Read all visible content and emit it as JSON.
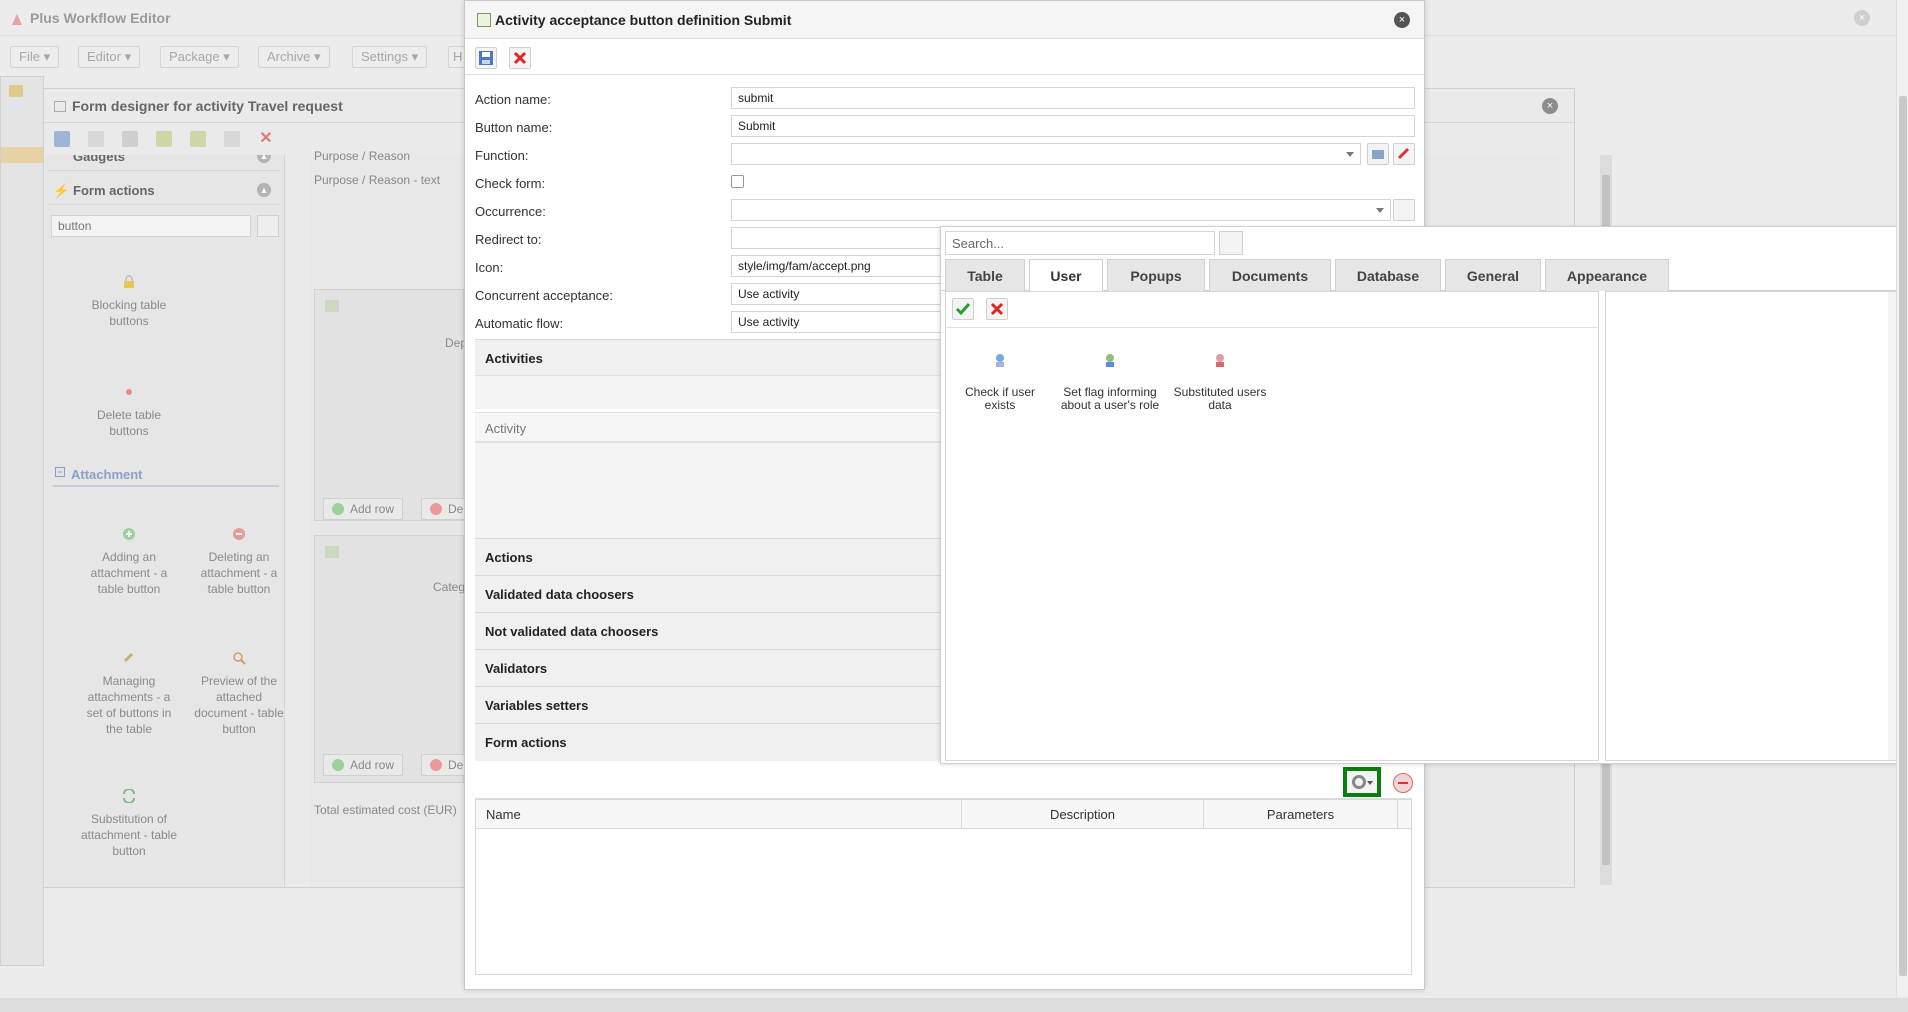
{
  "app": {
    "title": "Plus Workflow Editor",
    "menu": [
      "File",
      "Editor",
      "Package",
      "Archive",
      "Settings",
      "H"
    ]
  },
  "designer": {
    "title": "Form designer for activity Travel request",
    "panel": {
      "gadgets_header": "Gadgets",
      "form_actions_header": "Form actions",
      "search_value": "button",
      "items": [
        {
          "label": "Blocking table buttons",
          "icon": "lock-icon"
        },
        {
          "label": "Delete table buttons",
          "icon": "dot-icon"
        }
      ],
      "attachment_header": "Attachment",
      "attachment_items": [
        {
          "label": "Adding an attachment - a table button",
          "icon": "plus-circle-icon"
        },
        {
          "label": "Deleting an attachment - a table button",
          "icon": "minus-circle-icon"
        },
        {
          "label": "Managing attachments - a set of buttons in the table",
          "icon": "paperclip-icon"
        },
        {
          "label": "Preview of the attached document - table button",
          "icon": "magnifier-icon"
        },
        {
          "label": "Substitution of attachment - table button",
          "icon": "refresh-icon"
        }
      ]
    },
    "canvas": {
      "field_top": "Purpose / Reason",
      "field_text": "Purpose / Reason - text",
      "col1": "Dep",
      "col2": "Categ",
      "add_row": "Add row",
      "del_row": "De",
      "total": "Total estimated cost (EUR)"
    }
  },
  "dialog": {
    "title": "Activity acceptance button definition Submit",
    "fields": {
      "action_name_label": "Action name:",
      "action_name_value": "submit",
      "button_name_label": "Button name:",
      "button_name_value": "Submit",
      "function_label": "Function:",
      "check_form_label": "Check form:",
      "occurrence_label": "Occurrence:",
      "redirect_label": "Redirect to:",
      "icon_label": "Icon:",
      "icon_value": "style/img/fam/accept.png",
      "concurrent_label": "Concurrent acceptance:",
      "concurrent_value": "Use activity",
      "automatic_label": "Automatic flow:",
      "automatic_value": "Use activity"
    },
    "sections": {
      "activities": "Activities",
      "activity_sub": "Activity",
      "actions": "Actions",
      "validated": "Validated data choosers",
      "not_validated": "Not validated data choosers",
      "validators": "Validators",
      "variables": "Variables setters",
      "form_actions": "Form actions"
    },
    "grid": {
      "columns": [
        "Name",
        "Description",
        "Parameters"
      ]
    }
  },
  "chooser": {
    "search_placeholder": "Search...",
    "tabs": [
      "Table",
      "User",
      "Popups",
      "Documents",
      "Database",
      "General",
      "Appearance"
    ],
    "active_tab": "User",
    "items": [
      {
        "label": "Check if user exists",
        "icon": "user-search-icon"
      },
      {
        "label": "Set flag informing about a user's role",
        "icon": "user-flag-icon"
      },
      {
        "label": "Substituted users data",
        "icon": "user-icon"
      }
    ]
  }
}
